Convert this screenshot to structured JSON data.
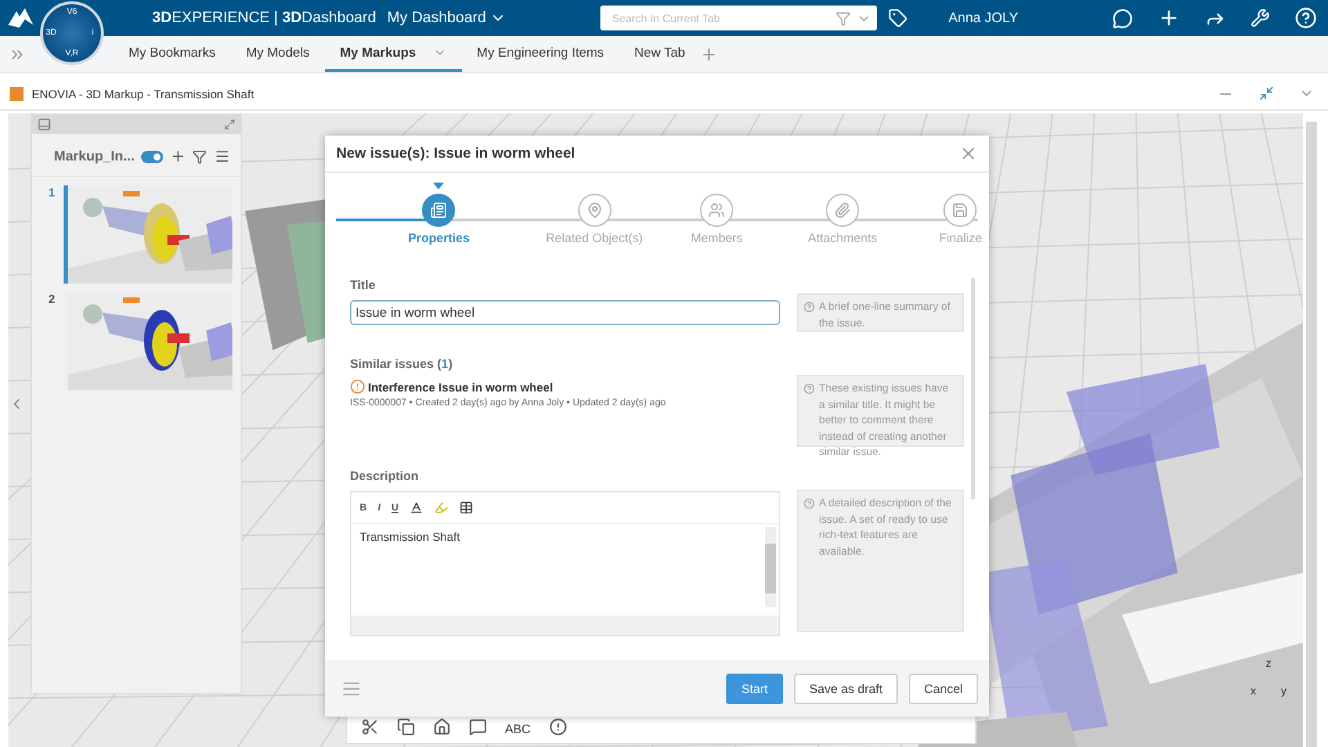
{
  "topbar": {
    "brand": "**3D**EXPERIENCE | **3D**Dashboard",
    "dashboard": "My Dashboard",
    "search": {
      "placeholder": "Search In Current Tab"
    },
    "user": "Anna JOLY",
    "compass": [
      "V6",
      "3D",
      "i",
      "V,R"
    ]
  },
  "tabs": [
    {
      "label": "My Bookmarks",
      "selected": false
    },
    {
      "label": "My Models",
      "selected": false
    },
    {
      "label": "My Markups",
      "selected": true
    },
    {
      "label": "My Engineering Items",
      "selected": false
    },
    {
      "label": "New Tab",
      "selected": false
    }
  ],
  "widget": {
    "title": "ENOVIA - 3D Markup - Transmission Shaft"
  },
  "markup_panel": {
    "title": "Markup_In...",
    "toggle_on": true,
    "slides": [
      {
        "number": "1",
        "selected": true
      },
      {
        "number": "2",
        "selected": false
      }
    ]
  },
  "dialog": {
    "title": "New issue(s): Issue in worm wheel",
    "steps": [
      {
        "label": "Properties",
        "selected": true
      },
      {
        "label": "Related Object(s)",
        "selected": false
      },
      {
        "label": "Members",
        "selected": false
      },
      {
        "label": "Attachments",
        "selected": false
      },
      {
        "label": "Finalize",
        "selected": false
      }
    ],
    "title_field": {
      "label": "Title",
      "value": "Issue in worm wheel",
      "hint": "A brief one-line summary of the issue."
    },
    "similar": {
      "label_before": "Similar issues (",
      "count": "1",
      "label_after": ")",
      "items": [
        {
          "title": "Interference Issue in worm wheel",
          "meta": "ISS-0000007 • Created 2 day(s) ago by Anna Joly • Updated 2 day(s) ago"
        }
      ],
      "hint": "These existing issues have a similar title. It might be better to comment there instead of creating another similar issue."
    },
    "description": {
      "label": "Description",
      "tools": [
        "B",
        "I",
        "U"
      ],
      "value": "Transmission Shaft",
      "hint": "A detailed description of the issue. A set of ready to use rich-text features are available."
    },
    "buttons": [
      {
        "label": "Start",
        "kind": "primary"
      },
      {
        "label": "Save as draft",
        "kind": "secondary"
      },
      {
        "label": "Cancel",
        "kind": "secondary"
      }
    ]
  },
  "viewer_toolbar": {
    "text_tool": "ABC"
  },
  "axes": [
    "z",
    "x",
    "y"
  ]
}
